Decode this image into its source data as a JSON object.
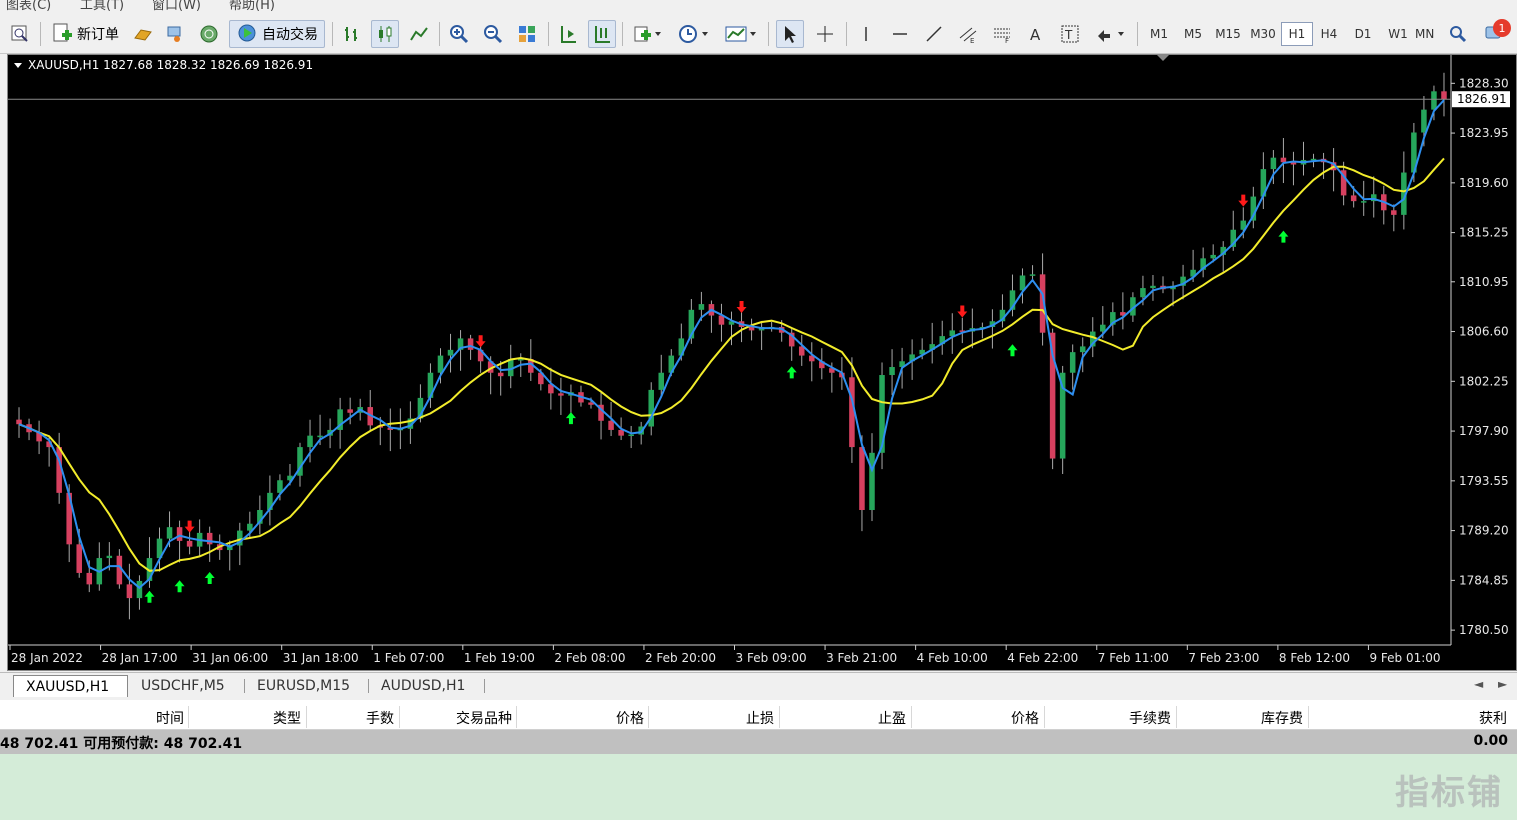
{
  "menu": [
    "图表(C)",
    "工具(T)",
    "窗口(W)",
    "帮助(H)"
  ],
  "toolbar": {
    "new_order_label": "新订单",
    "auto_trading_label": "自动交易",
    "timeframes": [
      "M1",
      "M5",
      "M15",
      "M30",
      "H1",
      "H4",
      "D1",
      "W1",
      "MN"
    ],
    "active_timeframe": "H1",
    "notification_count": "1"
  },
  "chart": {
    "header": "XAUUSD,H1  1827.68 1828.32 1826.69 1826.91",
    "current_price_label": "1826.91",
    "background": "#000000",
    "colors": {
      "bull_candle": "#26a65b",
      "bear_candle": "#d6405f",
      "fast_ma": "#2e8ff0",
      "slow_ma": "#f2ec2b",
      "buy_arrow": "#00ff33",
      "sell_arrow": "#ff1a1a"
    }
  },
  "chart_data": {
    "type": "candlestick",
    "symbol": "XAUUSD",
    "timeframe": "H1",
    "ylim": [
      1779.2,
      1830.6
    ],
    "y_ticks": [
      "1828.30",
      "1823.95",
      "1819.60",
      "1815.25",
      "1810.95",
      "1806.60",
      "1802.25",
      "1797.90",
      "1793.55",
      "1789.20",
      "1784.85",
      "1780.50"
    ],
    "x_ticks": [
      "28 Jan 2022",
      "28 Jan 17:00",
      "31 Jan 06:00",
      "31 Jan 18:00",
      "1 Feb 07:00",
      "1 Feb 19:00",
      "2 Feb 08:00",
      "2 Feb 20:00",
      "3 Feb 09:00",
      "3 Feb 21:00",
      "4 Feb 10:00",
      "4 Feb 22:00",
      "7 Feb 11:00",
      "7 Feb 23:00",
      "8 Feb 12:00",
      "9 Feb 01:00"
    ],
    "price_path": [
      1798.5,
      1797.8,
      1797.0,
      1796.5,
      1792.5,
      1788.0,
      1785.5,
      1784.5,
      1786.8,
      1787.0,
      1784.5,
      1783.3,
      1784.8,
      1786.8,
      1788.5,
      1789.5,
      1788.3,
      1787.8,
      1789.0,
      1788.0,
      1787.5,
      1787.9,
      1789.2,
      1789.8,
      1791.0,
      1792.5,
      1793.6,
      1794.0,
      1796.5,
      1797.5,
      1797.5,
      1798.0,
      1799.8,
      1799.5,
      1800.0,
      1798.4,
      1798.2,
      1798.0,
      1798.1,
      1799.0,
      1800.8,
      1803.0,
      1804.5,
      1805.0,
      1806.0,
      1805.0,
      1804.0,
      1803.0,
      1802.7,
      1804.2,
      1804.2,
      1803.0,
      1802.0,
      1801.2,
      1801.0,
      1801.3,
      1800.4,
      1800.2,
      1798.8,
      1798.0,
      1797.5,
      1797.6,
      1798.3,
      1801.5,
      1803.0,
      1804.5,
      1806.0,
      1808.5,
      1809.0,
      1808.0,
      1807.2,
      1807.5,
      1807.0,
      1806.7,
      1807.0,
      1807.0,
      1806.5,
      1805.3,
      1804.5,
      1804.0,
      1803.4,
      1803.0,
      1802.6,
      1796.5,
      1791.0,
      1796.0,
      1802.8,
      1803.5,
      1804.0,
      1804.6,
      1805.0,
      1805.5,
      1806.2,
      1806.7,
      1806.6,
      1806.9,
      1807.0,
      1807.5,
      1808.5,
      1810.2,
      1811.5,
      1811.6,
      1806.5,
      1795.5,
      1803.0,
      1804.8,
      1805.3,
      1806.6,
      1807.2,
      1808.3,
      1808.0,
      1809.6,
      1810.4,
      1810.6,
      1810.3,
      1810.6,
      1811.4,
      1812.0,
      1813.0,
      1813.3,
      1814.0,
      1815.5,
      1816.3,
      1818.4,
      1820.8,
      1821.8,
      1821.4,
      1821.2,
      1821.6,
      1821.7,
      1821.4,
      1820.7,
      1818.5,
      1818.0,
      1818.0,
      1818.6,
      1817.2,
      1816.8,
      1820.5,
      1824.0,
      1826.0,
      1827.6,
      1826.9
    ],
    "fast_ma_color": "blue",
    "slow_ma_color": "yellow",
    "buy_signals": [
      13,
      16,
      19,
      55,
      77,
      99,
      126
    ],
    "sell_signals": [
      17,
      46,
      72,
      94,
      122
    ]
  },
  "tabs": [
    "XAUUSD,H1",
    "USDCHF,M5",
    "EURUSD,M15",
    "AUDUSD,H1"
  ],
  "active_tab": "XAUUSD,H1",
  "terminal": {
    "columns": [
      "时间",
      "类型",
      "手数",
      "交易品种",
      "价格",
      "止损",
      "止盈",
      "价格",
      "手续费",
      "库存费",
      "获利"
    ],
    "balance_text": "48 702.41  可用预付款: 48 702.41",
    "profit_total": "0.00"
  },
  "watermark": "指标铺"
}
